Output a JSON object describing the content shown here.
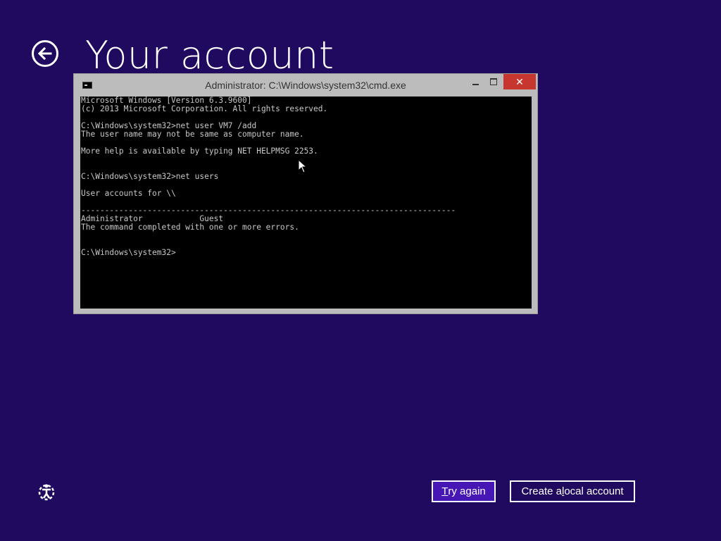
{
  "page": {
    "title": "Your account"
  },
  "cmd_window": {
    "title": "Administrator: C:\\Windows\\system32\\cmd.exe",
    "close_glyph": "✕",
    "lines": [
      "Microsoft Windows [Version 6.3.9600]",
      "(c) 2013 Microsoft Corporation. All rights reserved.",
      "",
      "C:\\Windows\\system32>net user VM7 /add",
      "The user name may not be same as computer name.",
      "",
      "More help is available by typing NET HELPMSG 2253.",
      "",
      "",
      "C:\\Windows\\system32>net users",
      "",
      "User accounts for \\\\",
      "",
      "-------------------------------------------------------------------------------",
      "Administrator            Guest",
      "The command completed with one or more errors.",
      "",
      "",
      "C:\\Windows\\system32>"
    ]
  },
  "buttons": {
    "try_again": {
      "pre": "",
      "u": "T",
      "post": "ry again"
    },
    "create_local": {
      "pre": "Create a ",
      "u": "l",
      "post": "ocal account"
    }
  },
  "icons": {
    "back": "back-arrow-icon",
    "ease_of_access": "ease-of-access-icon",
    "console": "console-icon",
    "cursor": "mouse-cursor-icon"
  },
  "colors": {
    "background": "#1f0a5f",
    "primary_button": "#4617b4",
    "close_button": "#c7372f"
  }
}
